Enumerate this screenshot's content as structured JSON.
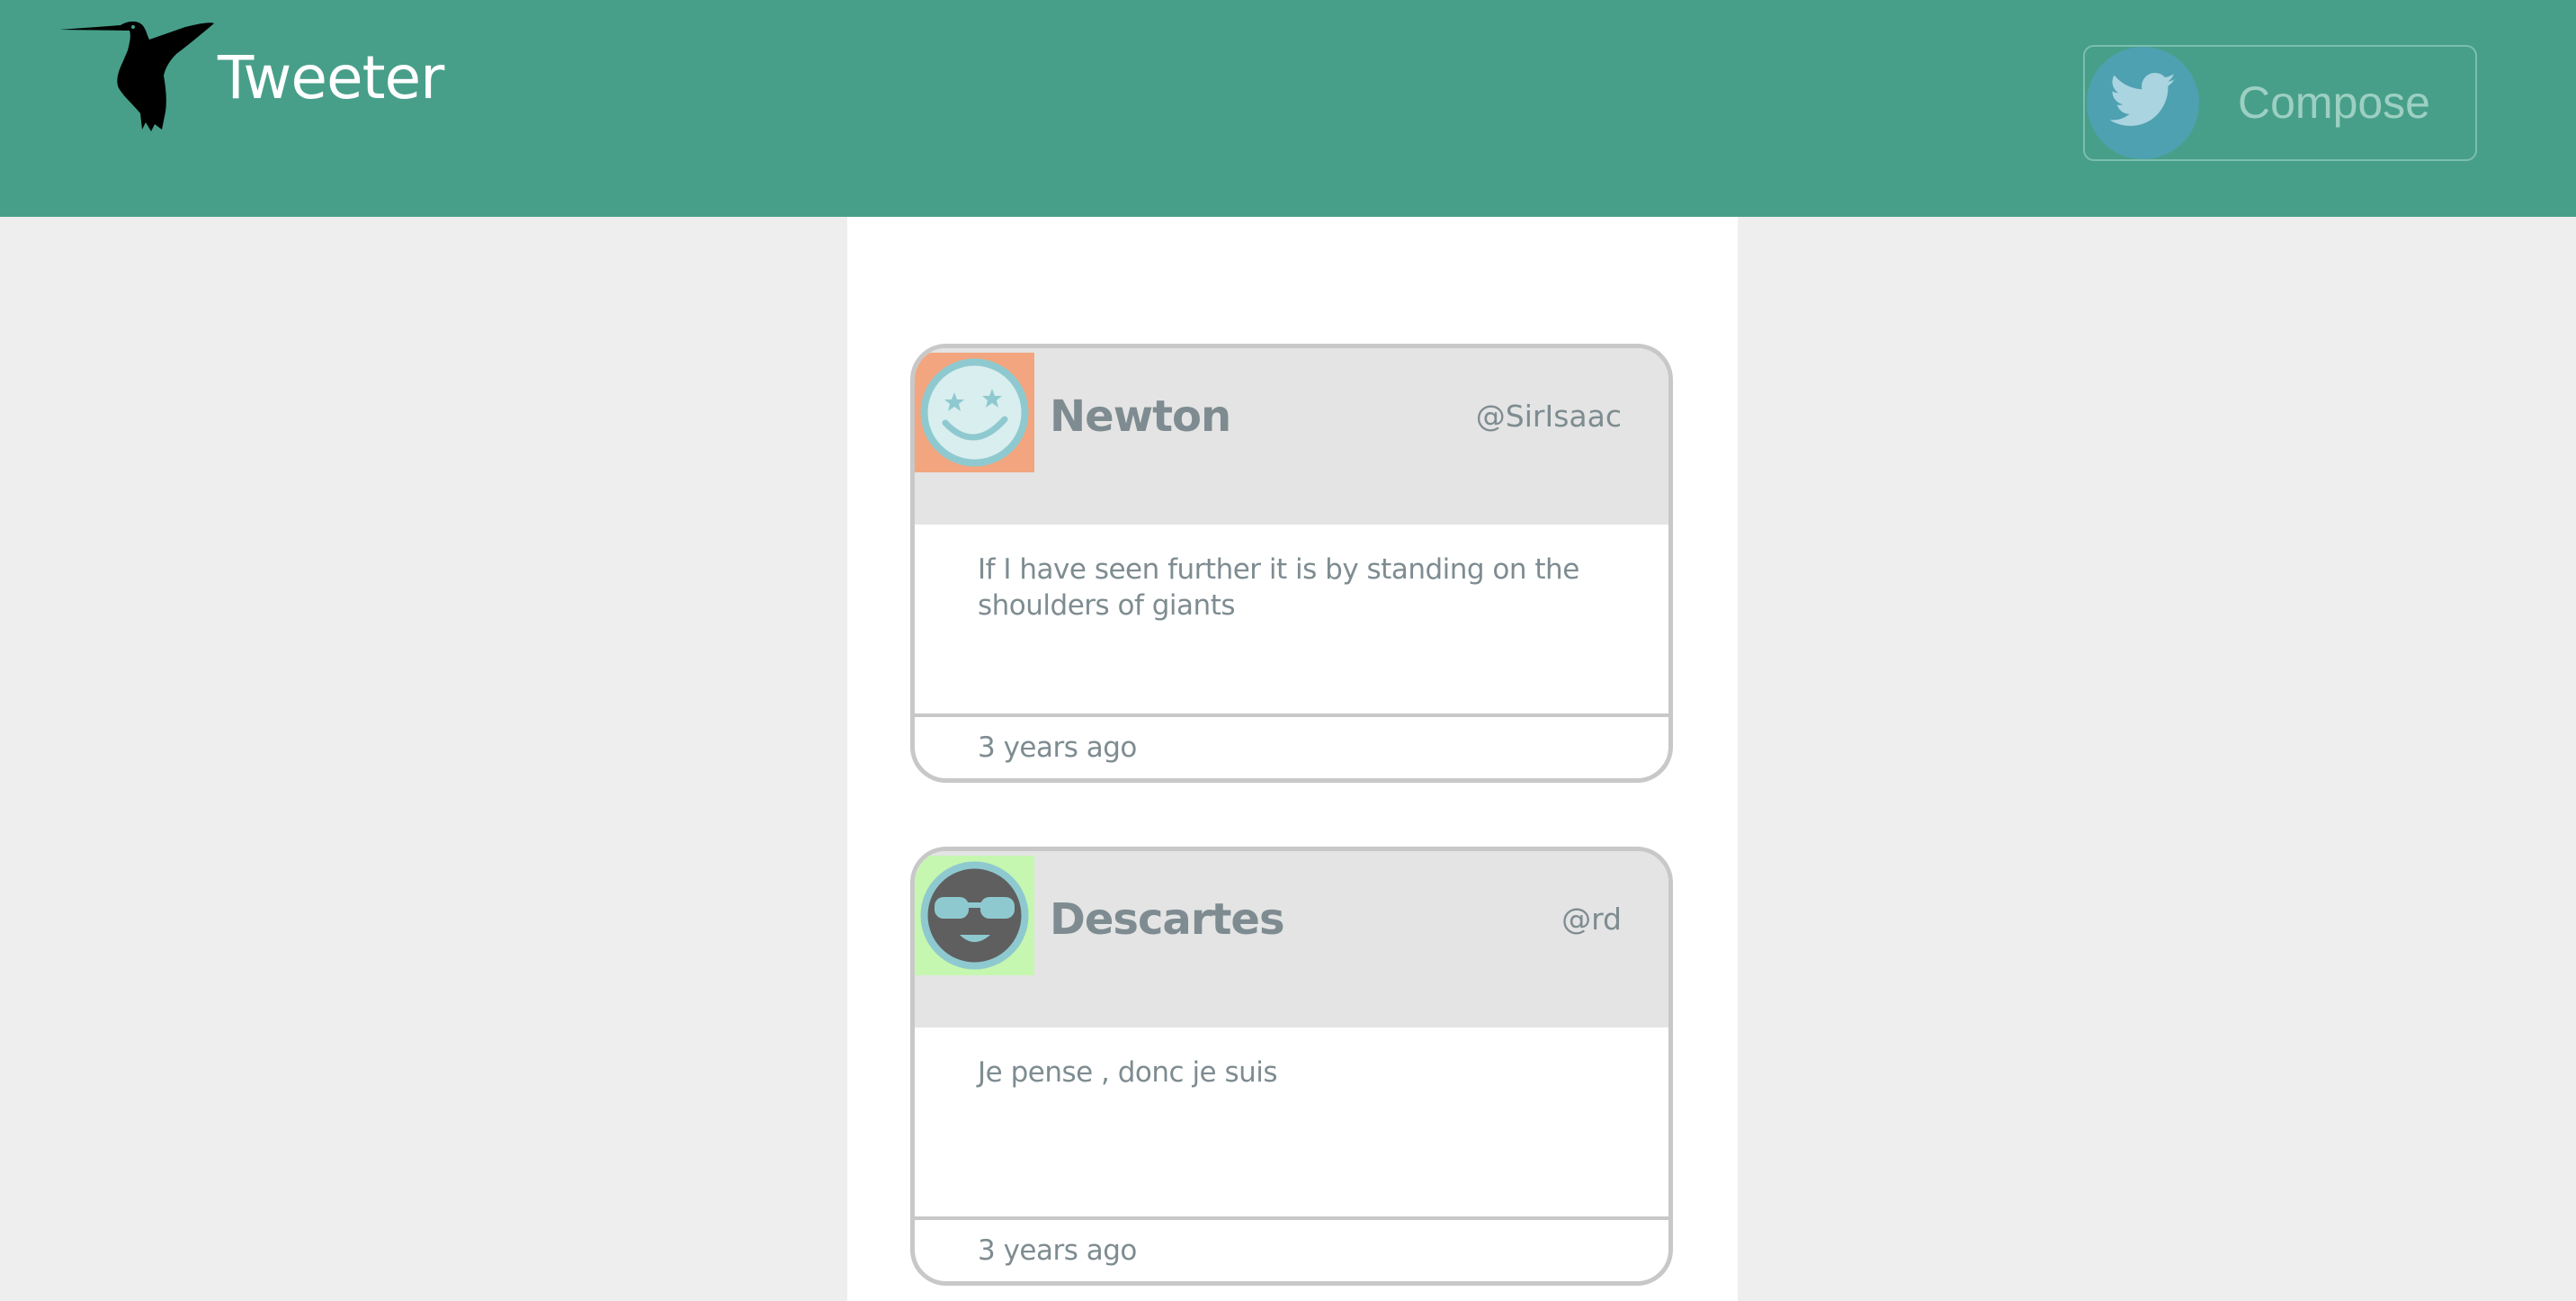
{
  "header": {
    "brand": "Tweeter",
    "logo_icon": "hummingbird-icon",
    "compose_label": "Compose",
    "compose_icon": "twitter-bird-icon",
    "colors": {
      "header_bg": "#479f89",
      "compose_circle": "#4ea1b0"
    }
  },
  "tweets": [
    {
      "name": "Newton",
      "handle": "@SirIsaac",
      "text": "If I have seen further it is by standing on the shoulders of giants",
      "time": "3 years ago",
      "avatar_icon": "star-eyes-smiley-icon",
      "avatar_bg": "#f2a57e"
    },
    {
      "name": "Descartes",
      "handle": "@rd",
      "text": "Je pense , donc je suis",
      "time": "3 years ago",
      "avatar_icon": "sunglasses-smiley-icon",
      "avatar_bg": "#c6f7b0"
    }
  ]
}
